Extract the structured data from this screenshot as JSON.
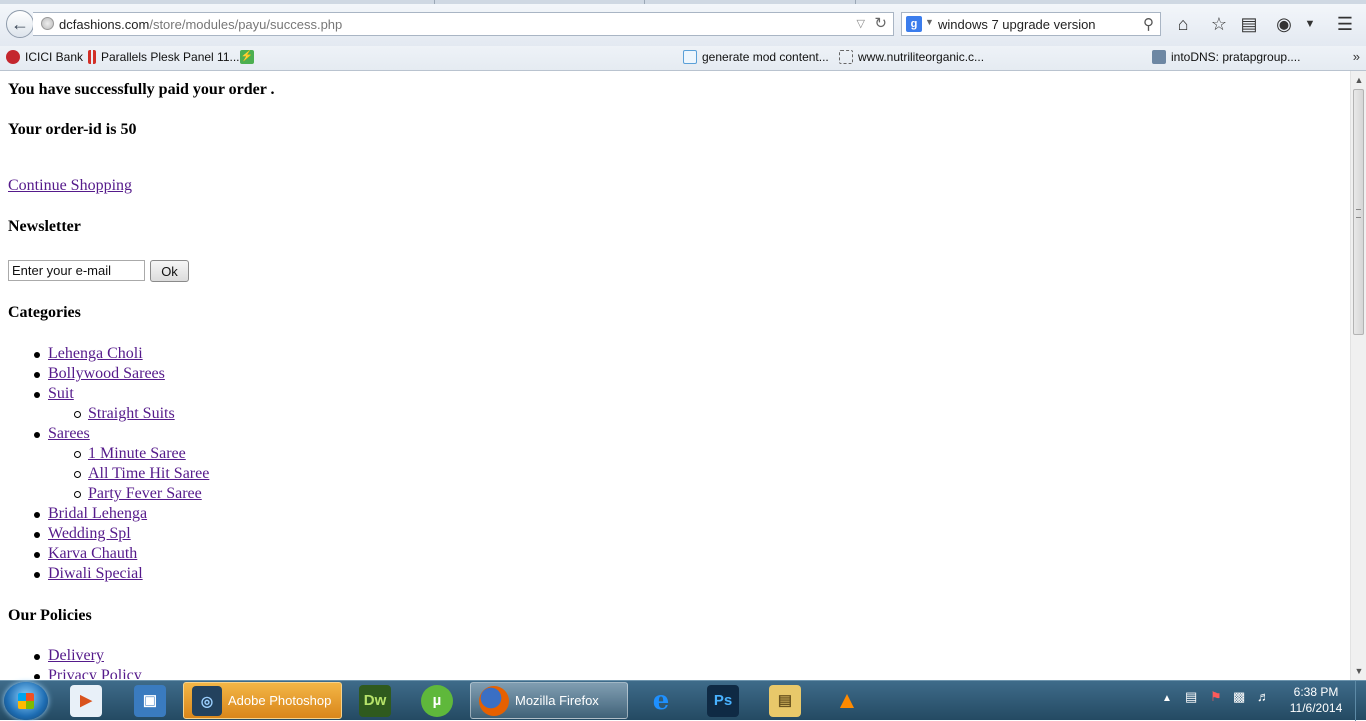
{
  "browser": {
    "url_host": "dcfashions.com",
    "url_path": "/store/modules/payu/success.php",
    "search_query": "windows 7 upgrade version",
    "search_engine_glyph": "g"
  },
  "bookmarks": [
    {
      "label": "ICICI Bank",
      "icon": "icici-icon",
      "color": "#c4272e"
    },
    {
      "label": "Parallels Plesk Panel 11...",
      "icon": "plesk-icon",
      "color": "#d22f27"
    },
    {
      "label": "",
      "icon": "bolt-icon",
      "color": "#4caf50"
    },
    {
      "label": "generate mod content...",
      "icon": "page-icon",
      "color": "#5aa0d8"
    },
    {
      "label": "www.nutriliteorganic.c...",
      "icon": "blank-page-icon",
      "color": "#ffffff"
    },
    {
      "label": "intoDNS: pratapgroup....",
      "icon": "puzzle-icon",
      "color": "#6d87a3"
    }
  ],
  "page": {
    "success_message": "You have successfully paid your order .",
    "order_id_text": "Your order-id is 50",
    "continue_shopping": "Continue Shopping",
    "newsletter_title": "Newsletter",
    "newsletter_value": "Enter your e-mail",
    "newsletter_button": "Ok",
    "categories_title": "Categories",
    "categories": [
      {
        "label": "Lehenga Choli",
        "children": []
      },
      {
        "label": "Bollywood Sarees",
        "children": []
      },
      {
        "label": "Suit",
        "children": [
          "Straight Suits"
        ]
      },
      {
        "label": "Sarees",
        "children": [
          "1 Minute Saree",
          "All Time Hit Saree",
          "Party Fever Saree"
        ]
      },
      {
        "label": "Bridal Lehenga",
        "children": []
      },
      {
        "label": "Wedding Spl",
        "children": []
      },
      {
        "label": "Karva Chauth",
        "children": []
      },
      {
        "label": "Diwali Special",
        "children": []
      }
    ],
    "policies_title": "Our Policies",
    "policies": [
      "Delivery",
      "Privacy Policy"
    ],
    "link_color": "#551a8b"
  },
  "taskbar": {
    "tasks": [
      {
        "label": "Adobe Photoshop",
        "icon": "photoshop-loading-icon",
        "active": true
      },
      {
        "label": "Mozilla Firefox",
        "icon": "firefox-icon",
        "active": false
      }
    ],
    "pinned": [
      {
        "name": "media-player-icon",
        "glyph": "▶"
      },
      {
        "name": "network-icon",
        "glyph": "▣"
      },
      {
        "name": "dreamweaver-icon",
        "glyph": "Dw"
      },
      {
        "name": "utorrent-icon",
        "glyph": "µ"
      },
      {
        "name": "internet-explorer-icon",
        "glyph": "e"
      },
      {
        "name": "photoshop-icon",
        "glyph": "Ps"
      },
      {
        "name": "explorer-folder-icon",
        "glyph": "▤"
      },
      {
        "name": "vlc-icon",
        "glyph": "▲"
      }
    ],
    "time": "6:38 PM",
    "date": "11/6/2014"
  }
}
